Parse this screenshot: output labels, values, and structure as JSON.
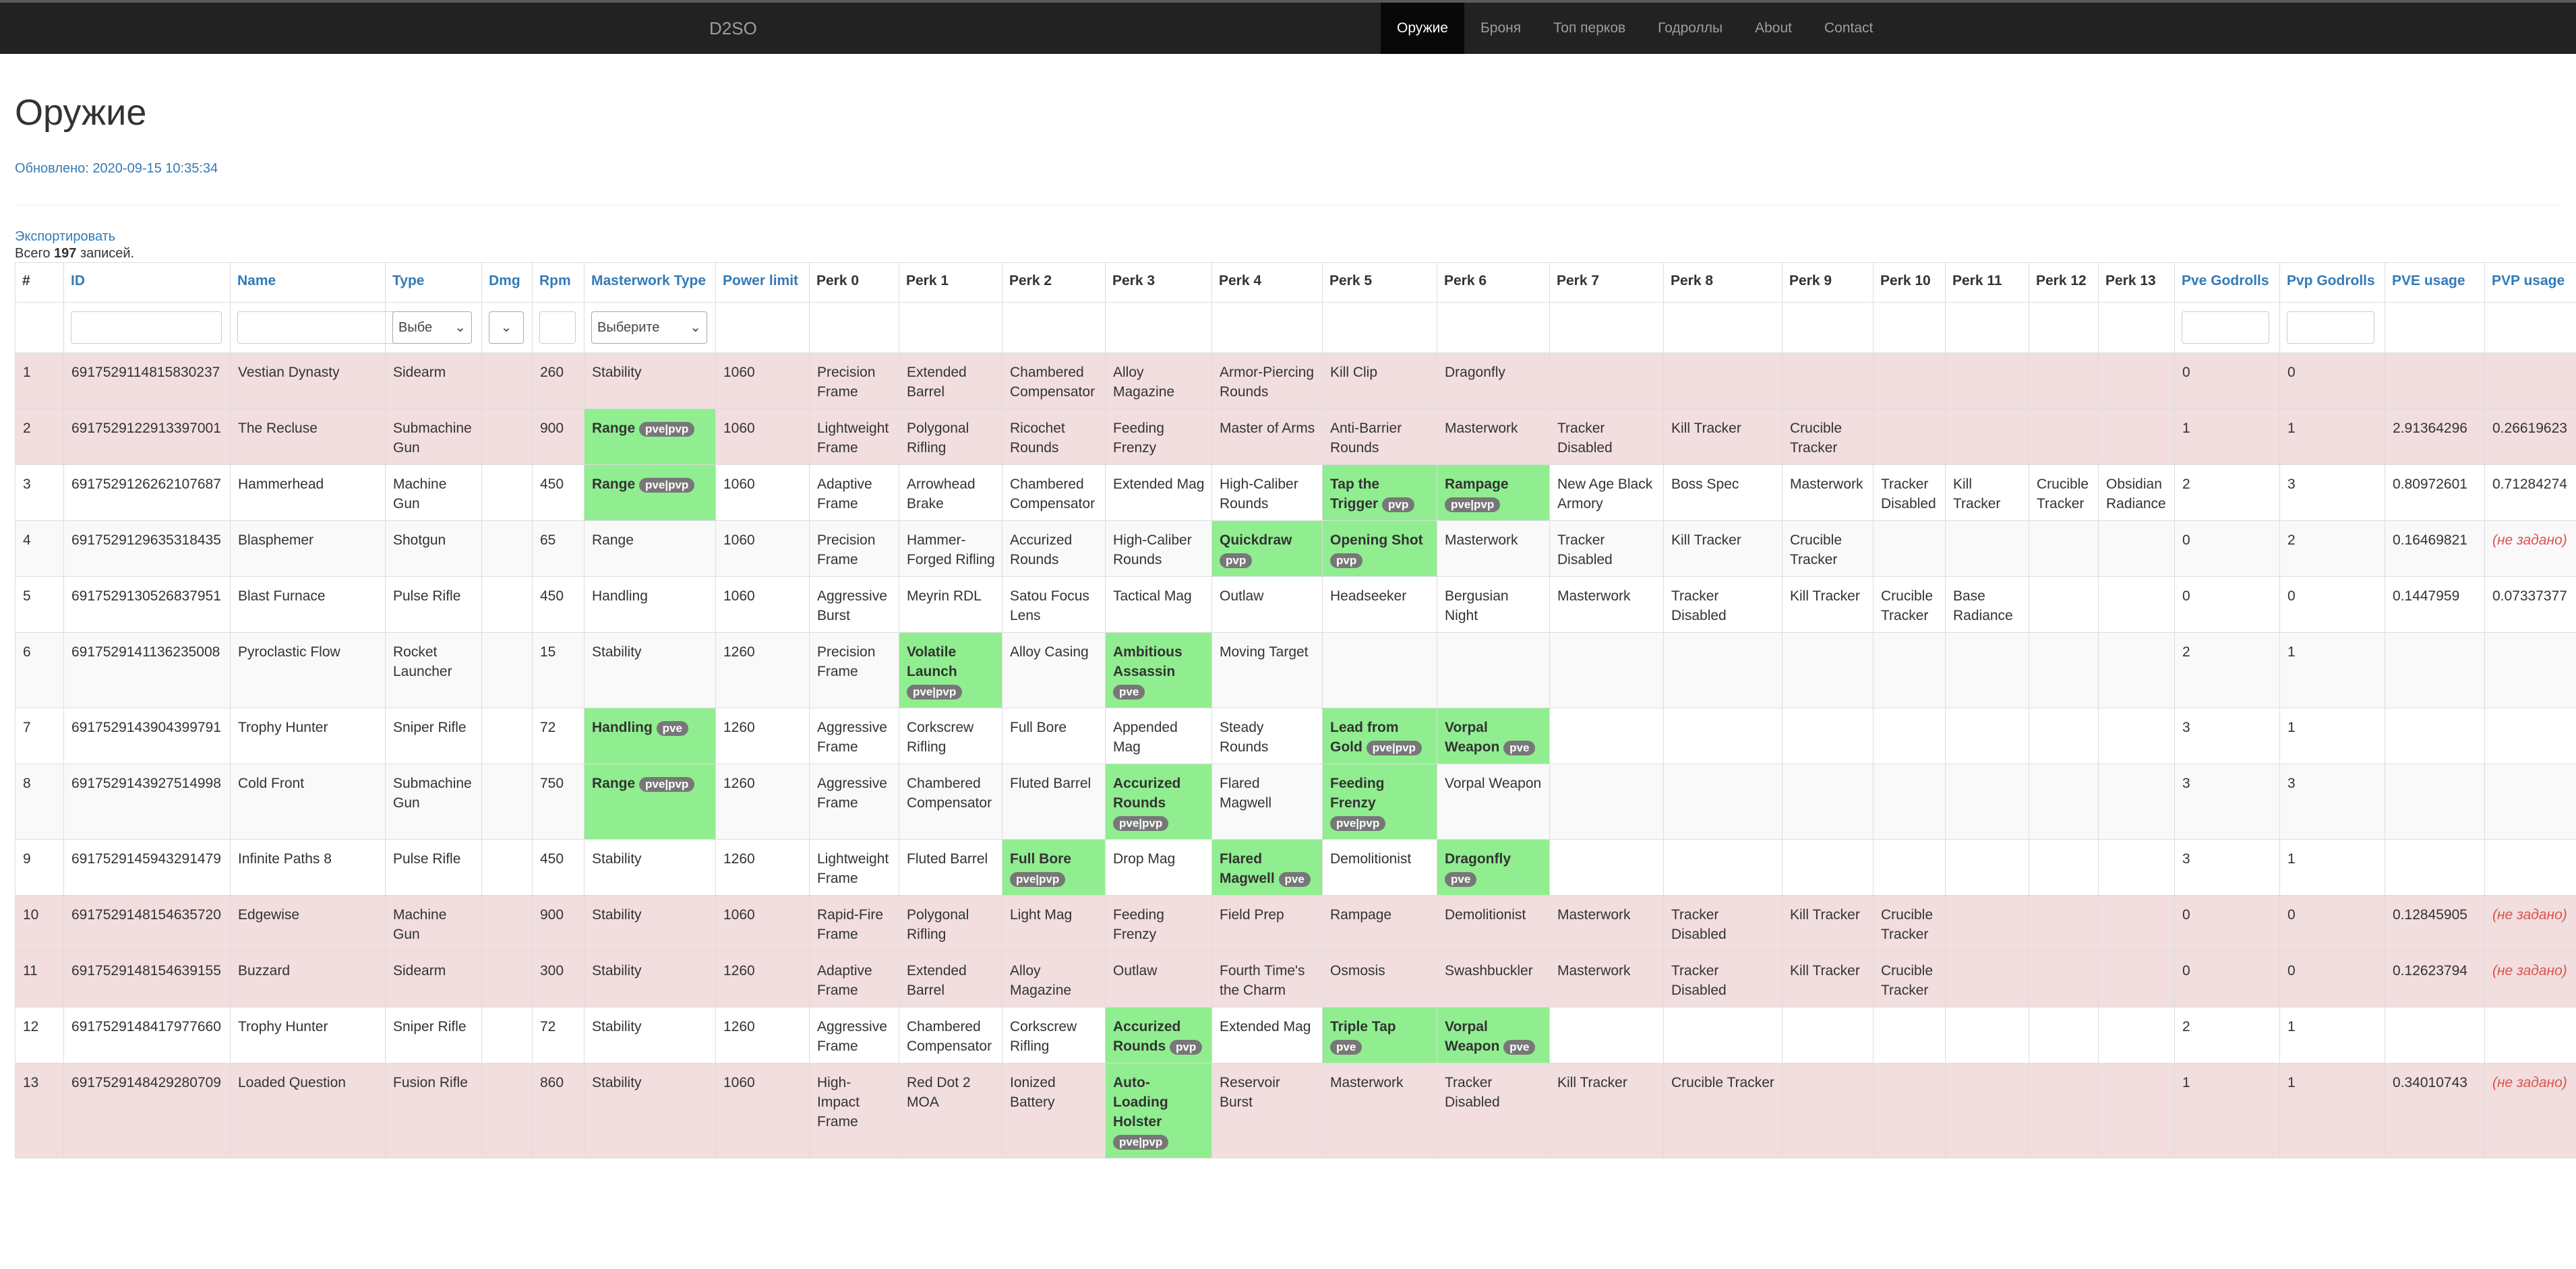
{
  "nav": {
    "brand": "D2SO",
    "items": [
      "Оружие",
      "Броня",
      "Топ перков",
      "Годроллы",
      "About",
      "Contact"
    ]
  },
  "page": {
    "title": "Оружие",
    "updated": "Обновлено: 2020-09-15 10:35:34",
    "export_label": "Экспортировать",
    "total_prefix": "Всего",
    "total_count": "197",
    "total_suffix": "записей."
  },
  "filters": {
    "type_placeholder": "Выбе",
    "masterwork_placeholder": "Выберите"
  },
  "colors": {
    "good": "#90ee90",
    "danger": "#f2dede",
    "badge": "#777777",
    "link": "#337ab7",
    "navbar": "#222222"
  },
  "columns": [
    {
      "label": "#",
      "sortable": false
    },
    {
      "label": "ID",
      "sortable": true
    },
    {
      "label": "Name",
      "sortable": true
    },
    {
      "label": "Type",
      "sortable": true
    },
    {
      "label": "Dmg",
      "sortable": true
    },
    {
      "label": "Rpm",
      "sortable": true
    },
    {
      "label": "Masterwork Type",
      "sortable": true
    },
    {
      "label": "Power limit",
      "sortable": true
    },
    {
      "label": "Perk 0",
      "sortable": false
    },
    {
      "label": "Perk 1",
      "sortable": false
    },
    {
      "label": "Perk 2",
      "sortable": false
    },
    {
      "label": "Perk 3",
      "sortable": false
    },
    {
      "label": "Perk 4",
      "sortable": false
    },
    {
      "label": "Perk 5",
      "sortable": false
    },
    {
      "label": "Perk 6",
      "sortable": false
    },
    {
      "label": "Perk 7",
      "sortable": false
    },
    {
      "label": "Perk 8",
      "sortable": false
    },
    {
      "label": "Perk 9",
      "sortable": false
    },
    {
      "label": "Perk 10",
      "sortable": false
    },
    {
      "label": "Perk 11",
      "sortable": false
    },
    {
      "label": "Perk 12",
      "sortable": false
    },
    {
      "label": "Perk 13",
      "sortable": false
    },
    {
      "label": "Pve Godrolls",
      "sortable": true
    },
    {
      "label": "Pvp Godrolls",
      "sortable": true
    },
    {
      "label": "PVE usage",
      "sortable": true
    },
    {
      "label": "PVP usage",
      "sortable": true
    }
  ],
  "unset_label": "(не задано)",
  "rows": [
    {
      "style": "danger",
      "cells": [
        {
          "t": "1"
        },
        {
          "t": "6917529114815830237"
        },
        {
          "t": "Vestian Dynasty"
        },
        {
          "t": "Sidearm"
        },
        {
          "t": ""
        },
        {
          "t": "260"
        },
        {
          "t": "Stability"
        },
        {
          "t": "1060"
        },
        {
          "t": "Precision Frame"
        },
        {
          "t": "Extended Barrel"
        },
        {
          "t": "Chambered Compensator"
        },
        {
          "t": "Alloy Magazine"
        },
        {
          "t": "Armor-Piercing Rounds"
        },
        {
          "t": "Kill Clip"
        },
        {
          "t": "Dragonfly"
        },
        {
          "t": ""
        },
        {
          "t": ""
        },
        {
          "t": ""
        },
        {
          "t": ""
        },
        {
          "t": ""
        },
        {
          "t": ""
        },
        {
          "t": ""
        },
        {
          "t": "0"
        },
        {
          "t": "0"
        },
        {
          "t": ""
        },
        {
          "t": ""
        }
      ]
    },
    {
      "style": "danger",
      "cells": [
        {
          "t": "2"
        },
        {
          "t": "6917529122913397001"
        },
        {
          "t": "The Recluse"
        },
        {
          "t": "Submachine Gun"
        },
        {
          "t": ""
        },
        {
          "t": "900"
        },
        {
          "t": "Range",
          "g": true,
          "b": "pve|pvp"
        },
        {
          "t": "1060"
        },
        {
          "t": "Lightweight Frame"
        },
        {
          "t": "Polygonal Rifling"
        },
        {
          "t": "Ricochet Rounds"
        },
        {
          "t": "Feeding Frenzy"
        },
        {
          "t": "Master of Arms"
        },
        {
          "t": "Anti-Barrier Rounds"
        },
        {
          "t": "Masterwork"
        },
        {
          "t": "Tracker Disabled"
        },
        {
          "t": "Kill Tracker"
        },
        {
          "t": "Crucible Tracker"
        },
        {
          "t": ""
        },
        {
          "t": ""
        },
        {
          "t": ""
        },
        {
          "t": ""
        },
        {
          "t": "1"
        },
        {
          "t": "1"
        },
        {
          "t": "2.91364296"
        },
        {
          "t": "0.26619623"
        }
      ]
    },
    {
      "style": "plain",
      "cells": [
        {
          "t": "3"
        },
        {
          "t": "6917529126262107687"
        },
        {
          "t": "Hammerhead"
        },
        {
          "t": "Machine Gun"
        },
        {
          "t": ""
        },
        {
          "t": "450"
        },
        {
          "t": "Range",
          "g": true,
          "b": "pve|pvp"
        },
        {
          "t": "1060"
        },
        {
          "t": "Adaptive Frame"
        },
        {
          "t": "Arrowhead Brake"
        },
        {
          "t": "Chambered Compensator"
        },
        {
          "t": "Extended Mag"
        },
        {
          "t": "High-Caliber Rounds"
        },
        {
          "t": "Tap the Trigger",
          "g": true,
          "b": "pvp"
        },
        {
          "t": "Rampage",
          "g": true,
          "b": "pve|pvp"
        },
        {
          "t": "New Age Black Armory"
        },
        {
          "t": "Boss Spec"
        },
        {
          "t": "Masterwork"
        },
        {
          "t": "Tracker Disabled"
        },
        {
          "t": "Kill Tracker"
        },
        {
          "t": "Crucible Tracker"
        },
        {
          "t": "Obsidian Radiance"
        },
        {
          "t": "2"
        },
        {
          "t": "3"
        },
        {
          "t": "0.80972601"
        },
        {
          "t": "0.71284274"
        }
      ]
    },
    {
      "style": "odd",
      "cells": [
        {
          "t": "4"
        },
        {
          "t": "6917529129635318435"
        },
        {
          "t": "Blasphemer"
        },
        {
          "t": "Shotgun"
        },
        {
          "t": ""
        },
        {
          "t": "65"
        },
        {
          "t": "Range"
        },
        {
          "t": "1060"
        },
        {
          "t": "Precision Frame"
        },
        {
          "t": "Hammer-Forged Rifling"
        },
        {
          "t": "Accurized Rounds"
        },
        {
          "t": "High-Caliber Rounds"
        },
        {
          "t": "Quickdraw",
          "g": true,
          "b": "pvp"
        },
        {
          "t": "Opening Shot",
          "g": true,
          "b": "pvp"
        },
        {
          "t": "Masterwork"
        },
        {
          "t": "Tracker Disabled"
        },
        {
          "t": "Kill Tracker"
        },
        {
          "t": "Crucible Tracker"
        },
        {
          "t": ""
        },
        {
          "t": ""
        },
        {
          "t": ""
        },
        {
          "t": ""
        },
        {
          "t": "0"
        },
        {
          "t": "2"
        },
        {
          "t": "0.16469821"
        },
        {
          "t": "(не задано)",
          "u": true
        }
      ]
    },
    {
      "style": "plain",
      "cells": [
        {
          "t": "5"
        },
        {
          "t": "6917529130526837951"
        },
        {
          "t": "Blast Furnace"
        },
        {
          "t": "Pulse Rifle"
        },
        {
          "t": ""
        },
        {
          "t": "450"
        },
        {
          "t": "Handling"
        },
        {
          "t": "1060"
        },
        {
          "t": "Aggressive Burst"
        },
        {
          "t": "Meyrin RDL"
        },
        {
          "t": "Satou Focus Lens"
        },
        {
          "t": "Tactical Mag"
        },
        {
          "t": "Outlaw"
        },
        {
          "t": "Headseeker"
        },
        {
          "t": "Bergusian Night"
        },
        {
          "t": "Masterwork"
        },
        {
          "t": "Tracker Disabled"
        },
        {
          "t": "Kill Tracker"
        },
        {
          "t": "Crucible Tracker"
        },
        {
          "t": "Base Radiance"
        },
        {
          "t": ""
        },
        {
          "t": ""
        },
        {
          "t": "0"
        },
        {
          "t": "0"
        },
        {
          "t": "0.1447959"
        },
        {
          "t": "0.07337377"
        }
      ]
    },
    {
      "style": "odd",
      "cells": [
        {
          "t": "6"
        },
        {
          "t": "6917529141136235008"
        },
        {
          "t": "Pyroclastic Flow"
        },
        {
          "t": "Rocket Launcher"
        },
        {
          "t": ""
        },
        {
          "t": "15"
        },
        {
          "t": "Stability"
        },
        {
          "t": "1260"
        },
        {
          "t": "Precision Frame"
        },
        {
          "t": "Volatile Launch",
          "g": true,
          "b": "pve|pvp"
        },
        {
          "t": "Alloy Casing"
        },
        {
          "t": "Ambitious Assassin",
          "g": true,
          "b": "pve"
        },
        {
          "t": "Moving Target"
        },
        {
          "t": ""
        },
        {
          "t": ""
        },
        {
          "t": ""
        },
        {
          "t": ""
        },
        {
          "t": ""
        },
        {
          "t": ""
        },
        {
          "t": ""
        },
        {
          "t": ""
        },
        {
          "t": ""
        },
        {
          "t": "2"
        },
        {
          "t": "1"
        },
        {
          "t": ""
        },
        {
          "t": ""
        }
      ]
    },
    {
      "style": "plain",
      "cells": [
        {
          "t": "7"
        },
        {
          "t": "6917529143904399791"
        },
        {
          "t": "Trophy Hunter"
        },
        {
          "t": "Sniper Rifle"
        },
        {
          "t": ""
        },
        {
          "t": "72"
        },
        {
          "t": "Handling",
          "g": true,
          "b": "pve"
        },
        {
          "t": "1260"
        },
        {
          "t": "Aggressive Frame"
        },
        {
          "t": "Corkscrew Rifling"
        },
        {
          "t": "Full Bore"
        },
        {
          "t": "Appended Mag"
        },
        {
          "t": "Steady Rounds"
        },
        {
          "t": "Lead from Gold",
          "g": true,
          "b": "pve|pvp"
        },
        {
          "t": "Vorpal Weapon",
          "g": true,
          "b": "pve"
        },
        {
          "t": ""
        },
        {
          "t": ""
        },
        {
          "t": ""
        },
        {
          "t": ""
        },
        {
          "t": ""
        },
        {
          "t": ""
        },
        {
          "t": ""
        },
        {
          "t": "3"
        },
        {
          "t": "1"
        },
        {
          "t": ""
        },
        {
          "t": ""
        }
      ]
    },
    {
      "style": "odd",
      "cells": [
        {
          "t": "8"
        },
        {
          "t": "6917529143927514998"
        },
        {
          "t": "Cold Front"
        },
        {
          "t": "Submachine Gun"
        },
        {
          "t": ""
        },
        {
          "t": "750"
        },
        {
          "t": "Range",
          "g": true,
          "b": "pve|pvp"
        },
        {
          "t": "1260"
        },
        {
          "t": "Aggressive Frame"
        },
        {
          "t": "Chambered Compensator"
        },
        {
          "t": "Fluted Barrel"
        },
        {
          "t": "Accurized Rounds",
          "g": true,
          "b": "pve|pvp"
        },
        {
          "t": "Flared Magwell"
        },
        {
          "t": "Feeding Frenzy",
          "g": true,
          "b": "pve|pvp"
        },
        {
          "t": "Vorpal Weapon"
        },
        {
          "t": ""
        },
        {
          "t": ""
        },
        {
          "t": ""
        },
        {
          "t": ""
        },
        {
          "t": ""
        },
        {
          "t": ""
        },
        {
          "t": ""
        },
        {
          "t": "3"
        },
        {
          "t": "3"
        },
        {
          "t": ""
        },
        {
          "t": ""
        }
      ]
    },
    {
      "style": "plain",
      "cells": [
        {
          "t": "9"
        },
        {
          "t": "6917529145943291479"
        },
        {
          "t": "Infinite Paths 8"
        },
        {
          "t": "Pulse Rifle"
        },
        {
          "t": ""
        },
        {
          "t": "450"
        },
        {
          "t": "Stability"
        },
        {
          "t": "1260"
        },
        {
          "t": "Lightweight Frame"
        },
        {
          "t": "Fluted Barrel"
        },
        {
          "t": "Full Bore",
          "g": true,
          "b": "pve|pvp"
        },
        {
          "t": "Drop Mag"
        },
        {
          "t": "Flared Magwell",
          "g": true,
          "b": "pve"
        },
        {
          "t": "Demolitionist"
        },
        {
          "t": "Dragonfly",
          "g": true,
          "b": "pve"
        },
        {
          "t": ""
        },
        {
          "t": ""
        },
        {
          "t": ""
        },
        {
          "t": ""
        },
        {
          "t": ""
        },
        {
          "t": ""
        },
        {
          "t": ""
        },
        {
          "t": "3"
        },
        {
          "t": "1"
        },
        {
          "t": ""
        },
        {
          "t": ""
        }
      ]
    },
    {
      "style": "danger",
      "cells": [
        {
          "t": "10"
        },
        {
          "t": "6917529148154635720"
        },
        {
          "t": "Edgewise"
        },
        {
          "t": "Machine Gun"
        },
        {
          "t": ""
        },
        {
          "t": "900"
        },
        {
          "t": "Stability"
        },
        {
          "t": "1060"
        },
        {
          "t": "Rapid-Fire Frame"
        },
        {
          "t": "Polygonal Rifling"
        },
        {
          "t": "Light Mag"
        },
        {
          "t": "Feeding Frenzy"
        },
        {
          "t": "Field Prep"
        },
        {
          "t": "Rampage"
        },
        {
          "t": "Demolitionist"
        },
        {
          "t": "Masterwork"
        },
        {
          "t": "Tracker Disabled"
        },
        {
          "t": "Kill Tracker"
        },
        {
          "t": "Crucible Tracker"
        },
        {
          "t": ""
        },
        {
          "t": ""
        },
        {
          "t": ""
        },
        {
          "t": "0"
        },
        {
          "t": "0"
        },
        {
          "t": "0.12845905"
        },
        {
          "t": "(не задано)",
          "u": true
        }
      ]
    },
    {
      "style": "danger",
      "cells": [
        {
          "t": "11"
        },
        {
          "t": "6917529148154639155"
        },
        {
          "t": "Buzzard"
        },
        {
          "t": "Sidearm"
        },
        {
          "t": ""
        },
        {
          "t": "300"
        },
        {
          "t": "Stability"
        },
        {
          "t": "1260"
        },
        {
          "t": "Adaptive Frame"
        },
        {
          "t": "Extended Barrel"
        },
        {
          "t": "Alloy Magazine"
        },
        {
          "t": "Outlaw"
        },
        {
          "t": "Fourth Time's the Charm"
        },
        {
          "t": "Osmosis"
        },
        {
          "t": "Swashbuckler"
        },
        {
          "t": "Masterwork"
        },
        {
          "t": "Tracker Disabled"
        },
        {
          "t": "Kill Tracker"
        },
        {
          "t": "Crucible Tracker"
        },
        {
          "t": ""
        },
        {
          "t": ""
        },
        {
          "t": ""
        },
        {
          "t": "0"
        },
        {
          "t": "0"
        },
        {
          "t": "0.12623794"
        },
        {
          "t": "(не задано)",
          "u": true
        }
      ]
    },
    {
      "style": "plain",
      "cells": [
        {
          "t": "12"
        },
        {
          "t": "6917529148417977660"
        },
        {
          "t": "Trophy Hunter"
        },
        {
          "t": "Sniper Rifle"
        },
        {
          "t": ""
        },
        {
          "t": "72"
        },
        {
          "t": "Stability"
        },
        {
          "t": "1260"
        },
        {
          "t": "Aggressive Frame"
        },
        {
          "t": "Chambered Compensator"
        },
        {
          "t": "Corkscrew Rifling"
        },
        {
          "t": "Accurized Rounds",
          "g": true,
          "b": "pvp"
        },
        {
          "t": "Extended Mag"
        },
        {
          "t": "Triple Tap",
          "g": true,
          "b": "pve"
        },
        {
          "t": "Vorpal Weapon",
          "g": true,
          "b": "pve"
        },
        {
          "t": ""
        },
        {
          "t": ""
        },
        {
          "t": ""
        },
        {
          "t": ""
        },
        {
          "t": ""
        },
        {
          "t": ""
        },
        {
          "t": ""
        },
        {
          "t": "2"
        },
        {
          "t": "1"
        },
        {
          "t": ""
        },
        {
          "t": ""
        }
      ]
    },
    {
      "style": "danger",
      "cells": [
        {
          "t": "13"
        },
        {
          "t": "6917529148429280709"
        },
        {
          "t": "Loaded Question"
        },
        {
          "t": "Fusion Rifle"
        },
        {
          "t": ""
        },
        {
          "t": "860"
        },
        {
          "t": "Stability"
        },
        {
          "t": "1060"
        },
        {
          "t": "High-Impact Frame"
        },
        {
          "t": "Red Dot 2 MOA"
        },
        {
          "t": "Ionized Battery"
        },
        {
          "t": "Auto-Loading Holster",
          "g": true,
          "b": "pve|pvp"
        },
        {
          "t": "Reservoir Burst"
        },
        {
          "t": "Masterwork"
        },
        {
          "t": "Tracker Disabled"
        },
        {
          "t": "Kill Tracker"
        },
        {
          "t": "Crucible Tracker"
        },
        {
          "t": ""
        },
        {
          "t": ""
        },
        {
          "t": ""
        },
        {
          "t": ""
        },
        {
          "t": ""
        },
        {
          "t": "1"
        },
        {
          "t": "1"
        },
        {
          "t": "0.34010743"
        },
        {
          "t": "(не задано)",
          "u": true
        }
      ]
    }
  ]
}
